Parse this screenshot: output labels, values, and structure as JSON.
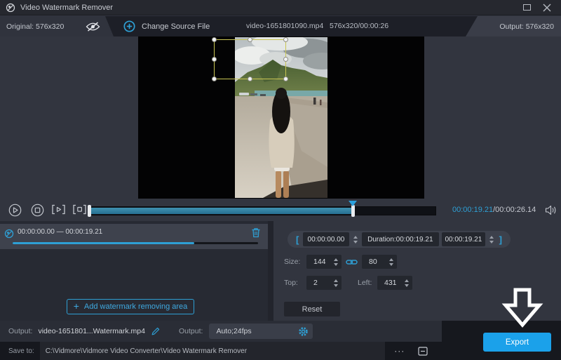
{
  "colors": {
    "accent": "#2e9fd4",
    "export_blue": "#1ba1ea",
    "selection_yellow": "#c9c553"
  },
  "titlebar": {
    "title": "Video Watermark Remover"
  },
  "topbar": {
    "original_label": "Original: 576x320",
    "change_source_label": "Change Source File",
    "filename": "video-1651801090.mp4",
    "file_info": "576x320/00:00:26",
    "output_label": "Output: 576x320"
  },
  "player": {
    "current_time": "00:00:19.21",
    "total_time": "/00:00:26.14"
  },
  "watermark_panel": {
    "item_range": "00:00:00.00 — 00:00:19.21",
    "add_plus": "+",
    "add_label": "Add watermark removing area"
  },
  "edit_panel": {
    "bracket_left": "[",
    "bracket_right": "]",
    "start_time": "00:00:00.00",
    "duration_label": "Duration:00:00:19.21",
    "end_time": "00:00:19.21",
    "size_label": "Size:",
    "size_width": "144",
    "size_height": "80",
    "top_label": "Top:",
    "top_value": "2",
    "left_label": "Left:",
    "left_value": "431",
    "reset_label": "Reset"
  },
  "footer": {
    "output_file_label": "Output:",
    "output_filename": "video-1651801...Watermark.mp4",
    "output_format_label": "Output:",
    "output_format_value": "Auto;24fps",
    "save_to_label": "Save to:",
    "save_path": "C:\\Vidmore\\Vidmore Video Converter\\Video Watermark Remover",
    "more_label": "···",
    "export_label": "Export"
  }
}
